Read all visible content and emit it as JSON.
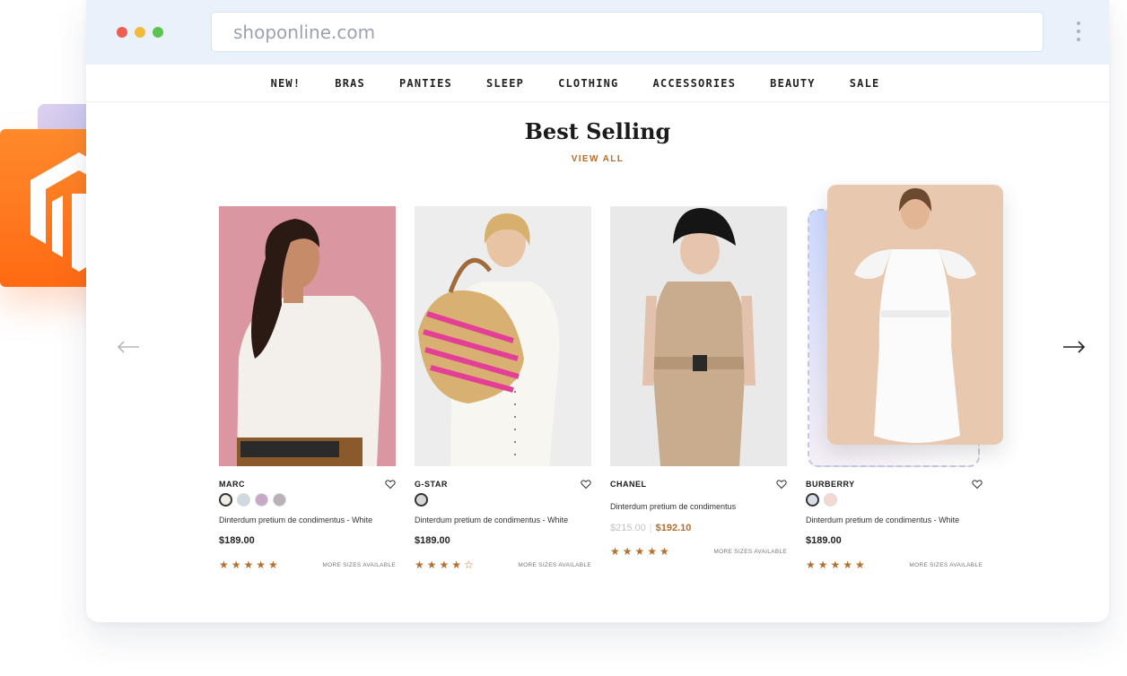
{
  "browser": {
    "url": "shoponline.com",
    "dots": [
      "#ee5d52",
      "#f4b93a",
      "#5cc451"
    ]
  },
  "nav": {
    "items": [
      "NEW!",
      "BRAS",
      "PANTIES",
      "SLEEP",
      "CLOTHING",
      "ACCESSORIES",
      "BEAUTY",
      "SALE"
    ]
  },
  "section": {
    "title": "Best Selling",
    "view_all": "VIEW ALL"
  },
  "products": [
    {
      "brand": "MARC",
      "desc": "Dinterdum pretium de condimentus - White",
      "price": "$189.00",
      "rating": 5,
      "stars": "★★★★★",
      "more": "MORE SIZES AVAILABLE",
      "swatches": [
        "#f2ece6",
        "#cfd9e0",
        "#c9a7c9",
        "#b9b0b8"
      ]
    },
    {
      "brand": "G-STAR",
      "desc": "Dinterdum pretium de condimentus - White",
      "price": "$189.00",
      "rating": 4.5,
      "stars": "★★★★☆",
      "more": "MORE SIZES AVAILABLE",
      "swatches": [
        "#d6d6d6"
      ]
    },
    {
      "brand": "CHANEL",
      "desc": "Dinterdum pretium de condimentus",
      "old_price": "$215.00",
      "sale_price": "$192.10",
      "separator": "|",
      "rating": 5,
      "stars": "★★★★★",
      "more": "MORE SIZES AVAILABLE"
    },
    {
      "brand": "BURBERRY",
      "desc": "Dinterdum pretium de condimentus - White",
      "price": "$189.00",
      "rating": 5,
      "stars": "★★★★★",
      "more": "MORE SIZES AVAILABLE",
      "swatches": [
        "#d7dde5",
        "#f3d9cf"
      ]
    }
  ],
  "colors": {
    "accent": "#b5702d",
    "brand_orange": "#ff7a1f",
    "chrome_bg": "#e9f1fb"
  },
  "icons": {
    "prev": "arrow-left-icon",
    "next": "arrow-right-icon",
    "wishlist": "heart-icon",
    "logo": "magento-logo-icon"
  }
}
